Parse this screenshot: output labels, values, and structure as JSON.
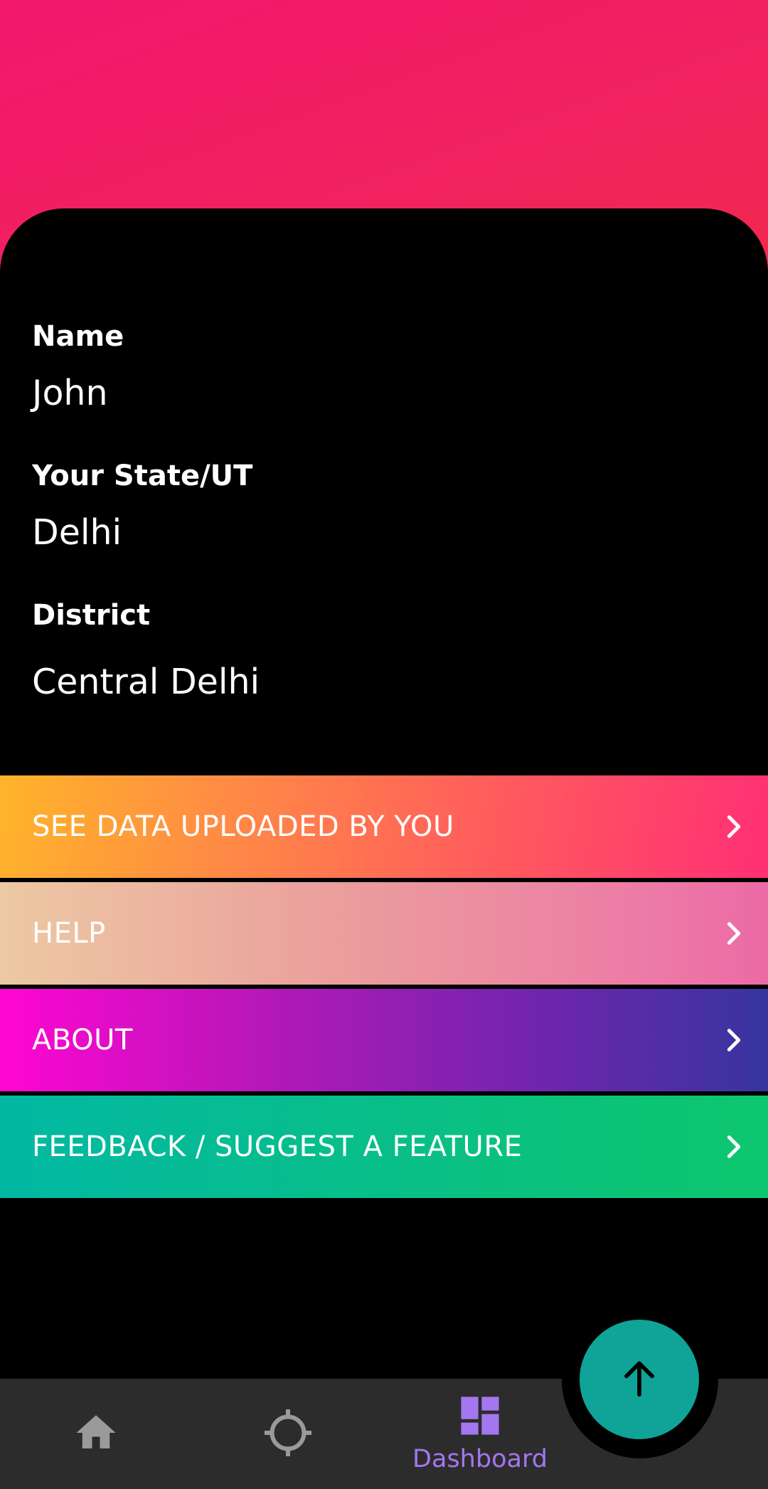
{
  "profile": {
    "name_label": "Name",
    "name_value": "John",
    "state_label": "Your State/UT",
    "state_value": "Delhi",
    "district_label": "District",
    "district_value": "Central Delhi"
  },
  "menu": {
    "items": [
      {
        "label": "SEE DATA UPLOADED BY YOU",
        "icon": "chevron-right-icon"
      },
      {
        "label": "HELP",
        "icon": "chevron-right-icon"
      },
      {
        "label": "ABOUT",
        "icon": "chevron-right-icon"
      },
      {
        "label": "FEEDBACK / SUGGEST A FEATURE",
        "icon": "chevron-right-icon"
      }
    ]
  },
  "bottom_nav": {
    "items": [
      {
        "icon": "home-icon"
      },
      {
        "icon": "crosshair-icon"
      },
      {
        "icon": "dashboard-icon",
        "label": "Dashboard",
        "active": true
      }
    ],
    "active_color": "#a476ef",
    "inactive_color": "#9a9a9a"
  },
  "fab": {
    "icon": "arrow-up-icon",
    "color": "#0fa497"
  },
  "colors": {
    "header": "#f2176d",
    "background": "#000000",
    "nav_background": "#2c2c2c"
  }
}
